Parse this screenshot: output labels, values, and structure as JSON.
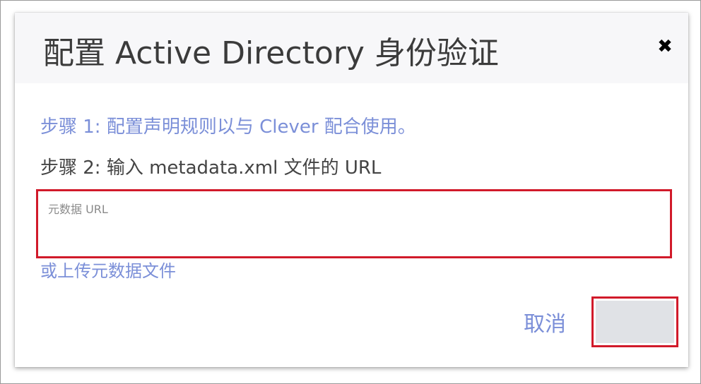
{
  "dialog": {
    "title": "配置 Active  Directory 身份验证",
    "close_glyph": "✖",
    "step1": "步骤 1: 配置声明规则以与 Clever 配合使用。",
    "step2": "步骤 2: 输入 metadata.xml 文件的 URL",
    "url_input": {
      "value": "",
      "placeholder": "元数据 URL"
    },
    "upload_link": "或上传元数据文件",
    "cancel_label": "取消"
  },
  "colors": {
    "link": "#7b8fd8",
    "highlight_border": "#d11a2a",
    "header_bg": "#f7f7f9",
    "ok_button_bg": "#e0e2e6"
  }
}
